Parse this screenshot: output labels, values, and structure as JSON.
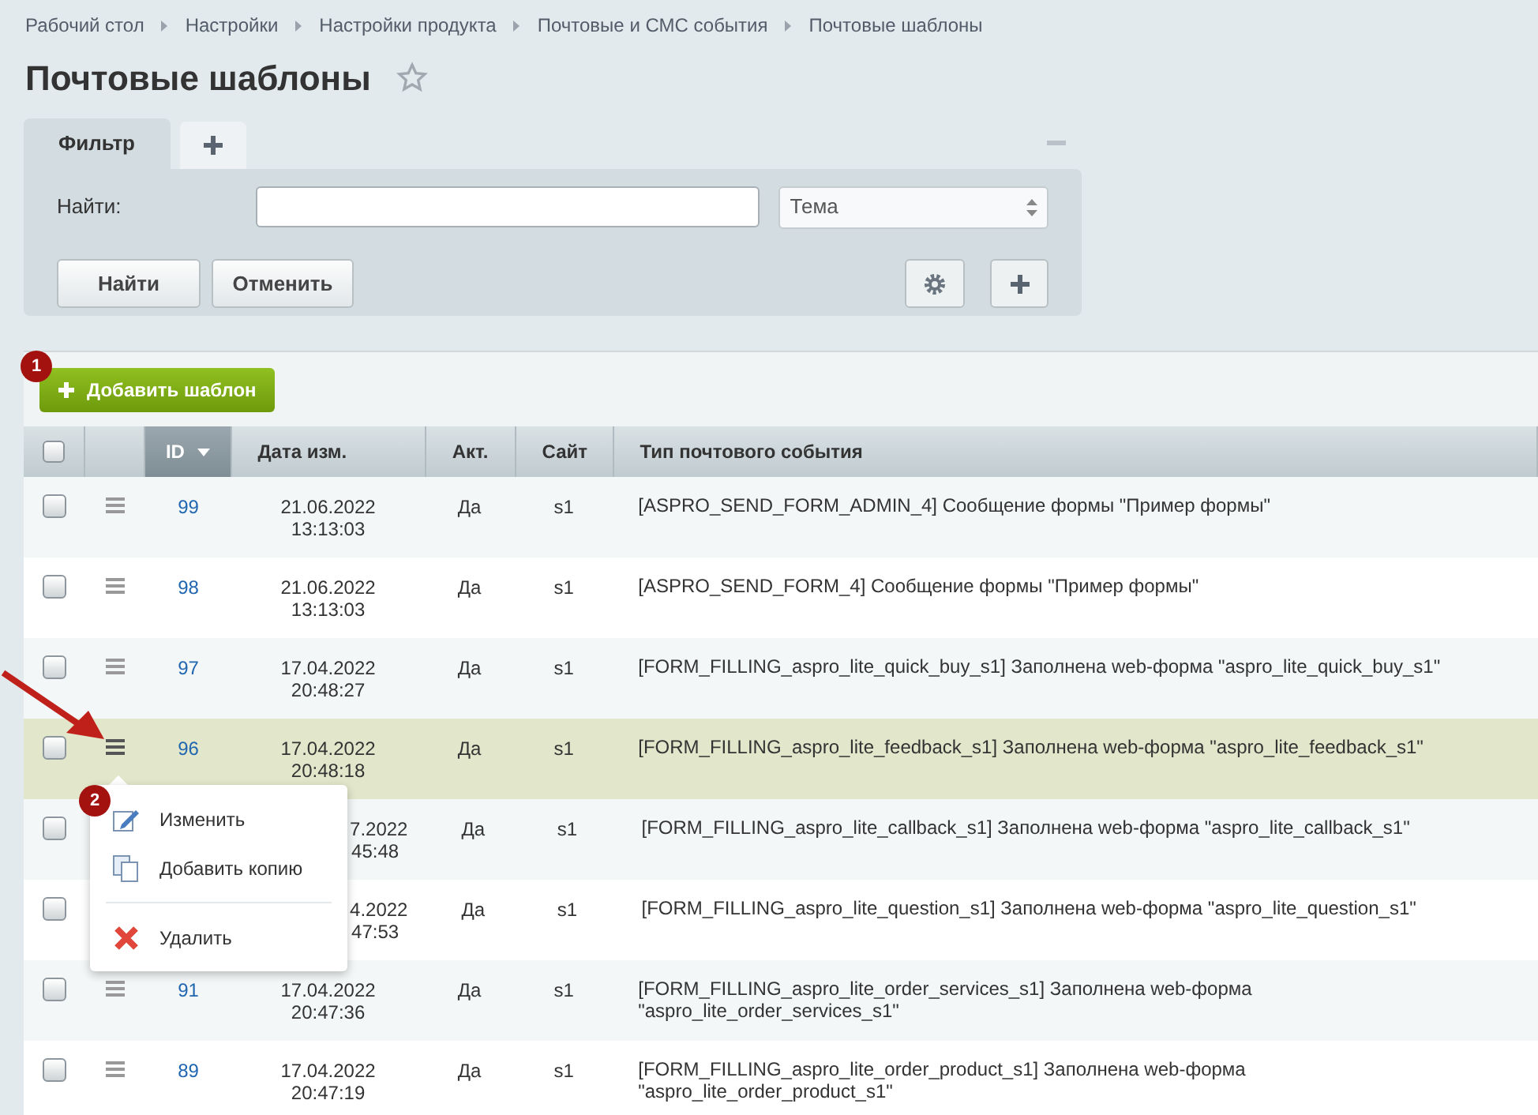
{
  "breadcrumbs": [
    "Рабочий стол",
    "Настройки",
    "Настройки продукта",
    "Почтовые и СМС события",
    "Почтовые шаблоны"
  ],
  "title": "Почтовые шаблоны",
  "filter": {
    "tabs": [
      {
        "label": "Фильтр",
        "selected": true
      }
    ],
    "find_label": "Найти:",
    "select": "Тема",
    "buttons": [
      "Найти",
      "Отменить"
    ]
  },
  "add_button": "Добавить шаблон",
  "markers": [
    "1",
    "2"
  ],
  "table": {
    "header_checked": false,
    "columns": [
      "ID",
      "Дата изм.",
      "Акт.",
      "Сайт",
      "Тип почтового события"
    ],
    "rows": [
      {
        "checked": false,
        "highlighted": false,
        "id": "99",
        "date": "21.06.2022",
        "time": "13:13:03",
        "active": "Да",
        "site": "s1",
        "type": "[ASPRO_SEND_FORM_ADMIN_4] Сообщение формы \"Пример формы\""
      },
      {
        "checked": false,
        "highlighted": false,
        "id": "98",
        "date": "21.06.2022",
        "time": "13:13:03",
        "active": "Да",
        "site": "s1",
        "type": "[ASPRO_SEND_FORM_4] Сообщение формы \"Пример формы\""
      },
      {
        "checked": false,
        "highlighted": false,
        "id": "97",
        "date": "17.04.2022",
        "time": "20:48:27",
        "active": "Да",
        "site": "s1",
        "type": "[FORM_FILLING_aspro_lite_quick_buy_s1] Заполнена web-форма \"aspro_lite_quick_buy_s1\""
      },
      {
        "checked": false,
        "highlighted": true,
        "id": "96",
        "date": "17.04.2022",
        "time": "20:48:18",
        "active": "Да",
        "site": "s1",
        "type": "[FORM_FILLING_aspro_lite_feedback_s1] Заполнена web-форма \"aspro_lite_feedback_s1\""
      },
      {
        "checked": false,
        "highlighted": false,
        "date": "7.2022",
        "time": "45:48",
        "active": "Да",
        "site": "s1",
        "type": "[FORM_FILLING_aspro_lite_callback_s1] Заполнена web-форма \"aspro_lite_callback_s1\""
      },
      {
        "checked": false,
        "highlighted": false,
        "date": "4.2022",
        "time": "47:53",
        "active": "Да",
        "site": "s1",
        "type": "[FORM_FILLING_aspro_lite_question_s1] Заполнена web-форма \"aspro_lite_question_s1\""
      },
      {
        "checked": false,
        "highlighted": false,
        "id": "91",
        "date": "17.04.2022",
        "time": "20:47:36",
        "active": "Да",
        "site": "s1",
        "type": "[FORM_FILLING_aspro_lite_order_services_s1] Заполнена web-форма \"aspro_lite_order_services_s1\""
      },
      {
        "checked": false,
        "highlighted": false,
        "id": "89",
        "date": "17.04.2022",
        "time": "20:47:19",
        "active": "Да",
        "site": "s1",
        "type": "[FORM_FILLING_aspro_lite_order_product_s1] Заполнена web-форма \"aspro_lite_order_product_s1\""
      }
    ]
  },
  "context_menu": {
    "items": [
      {
        "kind": "edit",
        "label": "Изменить"
      },
      {
        "kind": "copy",
        "label": "Добавить копию"
      },
      {
        "kind": "delete",
        "label": "Удалить"
      }
    ]
  }
}
